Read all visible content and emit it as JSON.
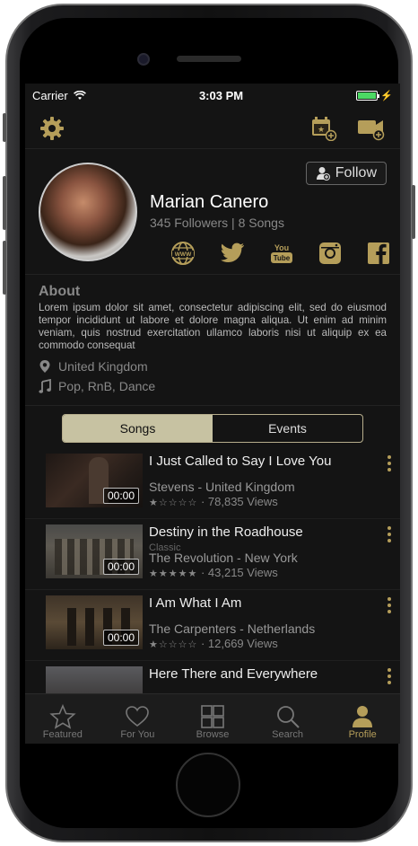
{
  "status": {
    "carrier": "Carrier",
    "time": "3:03 PM",
    "battery_level": 1.0
  },
  "colors": {
    "accent": "#b59e5a",
    "segment_active": "#c7c2a2",
    "battery": "#4cd964"
  },
  "profile": {
    "name": "Marian Canero",
    "stats": "345 Followers | 8 Songs",
    "follow_label": "Follow",
    "socials": [
      "www-icon",
      "twitter-icon",
      "youtube-icon",
      "instagram-icon",
      "facebook-icon"
    ]
  },
  "about": {
    "title": "About",
    "text": "Lorem ipsum dolor sit amet, consectetur adipiscing elit, sed do eiusmod tempor incididunt ut labore et dolore magna aliqua. Ut enim ad minim veniam, quis nostrud exercitation ullamco laboris nisi ut aliquip ex ea commodo consequat",
    "location": "United Kingdom",
    "genres": "Pop, RnB, Dance"
  },
  "segments": {
    "songs": "Songs",
    "events": "Events"
  },
  "songs": [
    {
      "title": "I Just Called to Say I Love You",
      "genre": "",
      "artist": "Stevens - United Kingdom",
      "stars": "★☆☆☆☆",
      "views": "78,835 Views",
      "duration": "00:00"
    },
    {
      "title": "Destiny in the Roadhouse",
      "genre": "Classic",
      "artist": "The Revolution - New York",
      "stars": "★★★★★",
      "views": "43,215 Views",
      "duration": "00:00"
    },
    {
      "title": "I Am What I Am",
      "genre": "",
      "artist": "The Carpenters - Netherlands",
      "stars": "★☆☆☆☆",
      "views": "12,669 Views",
      "duration": "00:00"
    },
    {
      "title": "Here There and Everywhere",
      "genre": "",
      "artist": "",
      "stars": "",
      "views": "",
      "duration": ""
    }
  ],
  "tabs": [
    {
      "label": "Featured",
      "icon": "star-icon"
    },
    {
      "label": "For You",
      "icon": "heart-icon"
    },
    {
      "label": "Browse",
      "icon": "grid-icon"
    },
    {
      "label": "Search",
      "icon": "search-icon"
    },
    {
      "label": "Profile",
      "icon": "person-icon"
    }
  ]
}
